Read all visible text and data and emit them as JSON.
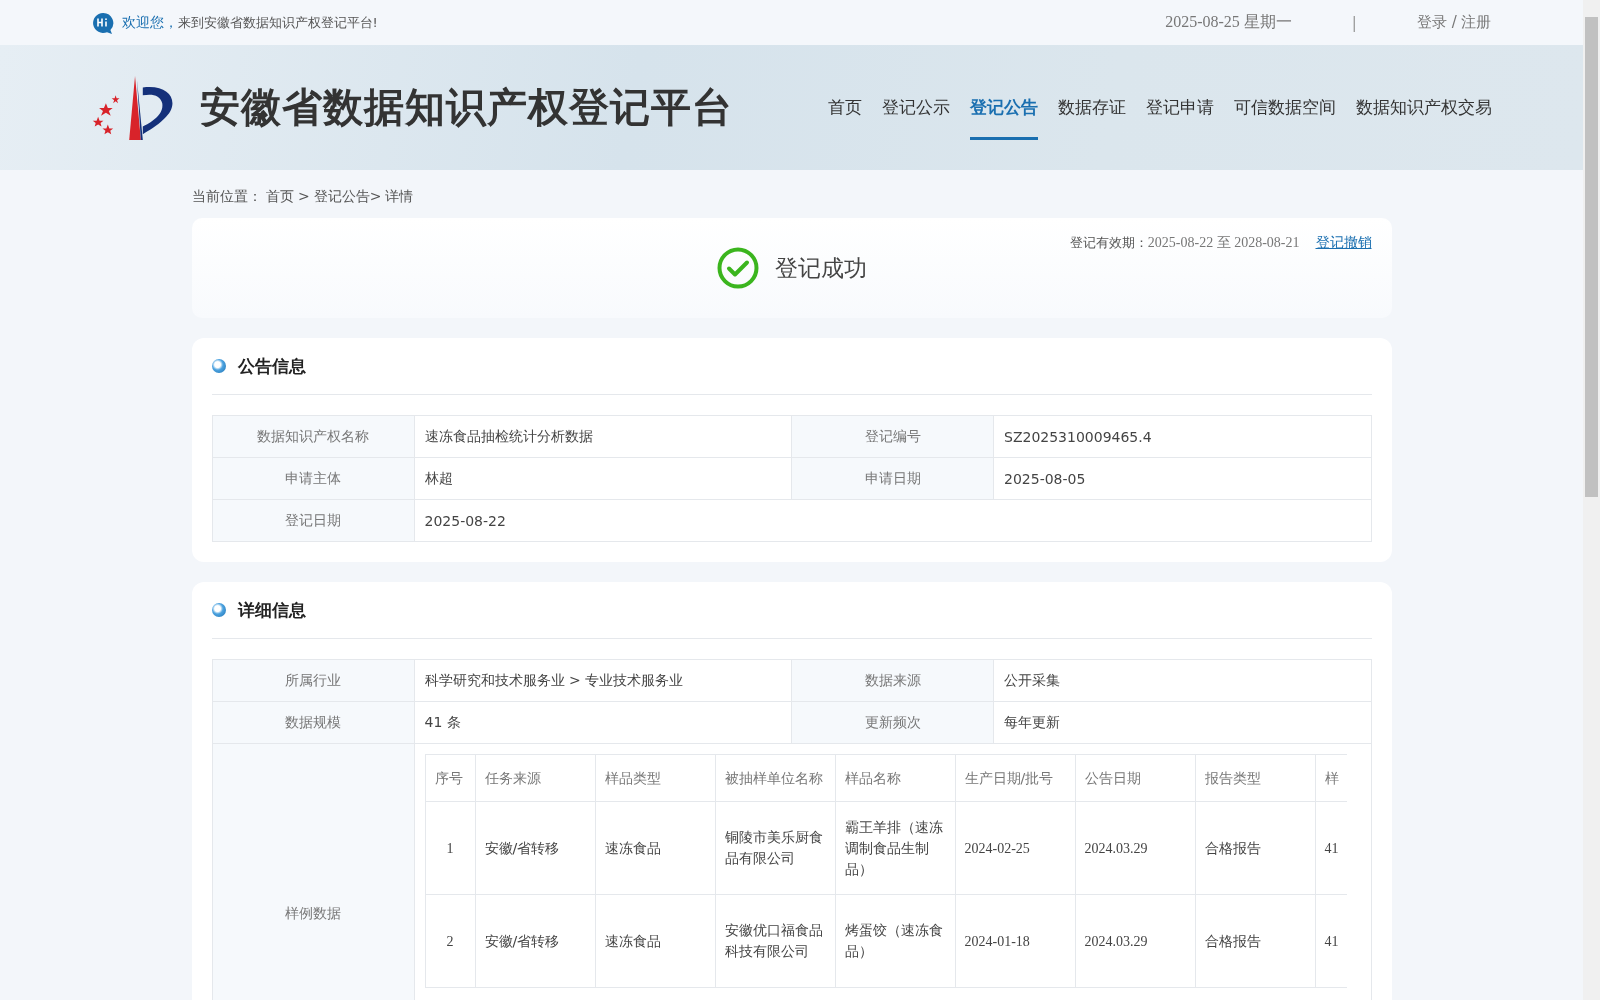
{
  "top_bar": {
    "greeting": "欢迎您，",
    "welcome": "来到安徽省数据知识产权登记平台!",
    "date": "2025-08-25 星期一",
    "separator": "|",
    "auth": "登录 / 注册"
  },
  "header": {
    "title": "安徽省数据知识产权登记平台",
    "nav": [
      {
        "label": "首页",
        "selected": false
      },
      {
        "label": "登记公示",
        "selected": false
      },
      {
        "label": "登记公告",
        "selected": true
      },
      {
        "label": "数据存证",
        "selected": false
      },
      {
        "label": "登记申请",
        "selected": false
      },
      {
        "label": "可信数据空间",
        "selected": false
      },
      {
        "label": "数据知识产权交易",
        "selected": false
      }
    ]
  },
  "breadcrumb": {
    "label": "当前位置：",
    "items": [
      "首页 > ",
      "登记公告> ",
      "详情"
    ]
  },
  "status_card": {
    "status": "登记成功",
    "validity_label": "登记有效期：",
    "validity": "2025-08-22 至 2028-08-21",
    "revoke_link": "登记撤销"
  },
  "announcement": {
    "title": "公告信息",
    "rows": [
      [
        {
          "label": "数据知识产权名称",
          "value": "速冻食品抽检统计分析数据"
        },
        {
          "label": "登记编号",
          "value": "SZ2025310009465.4"
        }
      ],
      [
        {
          "label": "申请主体",
          "value": "林超"
        },
        {
          "label": "申请日期",
          "value": "2025-08-05"
        }
      ],
      [
        {
          "label": "登记日期",
          "value": "2025-08-22"
        }
      ]
    ]
  },
  "details": {
    "title": "详细信息",
    "rows": [
      [
        {
          "label": "所属行业",
          "value": "科学研究和技术服务业 > 专业技术服务业"
        },
        {
          "label": "数据来源",
          "value": "公开采集"
        }
      ],
      [
        {
          "label": "数据规模",
          "value": "41 条"
        },
        {
          "label": "更新频次",
          "value": "每年更新"
        }
      ]
    ],
    "sample_label": "样例数据",
    "sample_table": {
      "columns": [
        "序号",
        "任务来源",
        "样品类型",
        "被抽样单位名称",
        "样品名称",
        "生产日期/批号",
        "公告日期",
        "报告类型",
        "样"
      ],
      "rows": [
        [
          "1",
          "安徽/省转移",
          "速冻食品",
          "铜陵市美乐厨食品有限公司",
          "霸王羊排（速冻调制食品生制品）",
          "2024-02-25",
          "2024.03.29",
          "合格报告",
          "41"
        ],
        [
          "2",
          "安徽/省转移",
          "速冻食品",
          "安徽优口福食品科技有限公司",
          "烤蛋饺（速冻食品）",
          "2024-01-18",
          "2024.03.29",
          "合格报告",
          "41"
        ]
      ]
    }
  }
}
